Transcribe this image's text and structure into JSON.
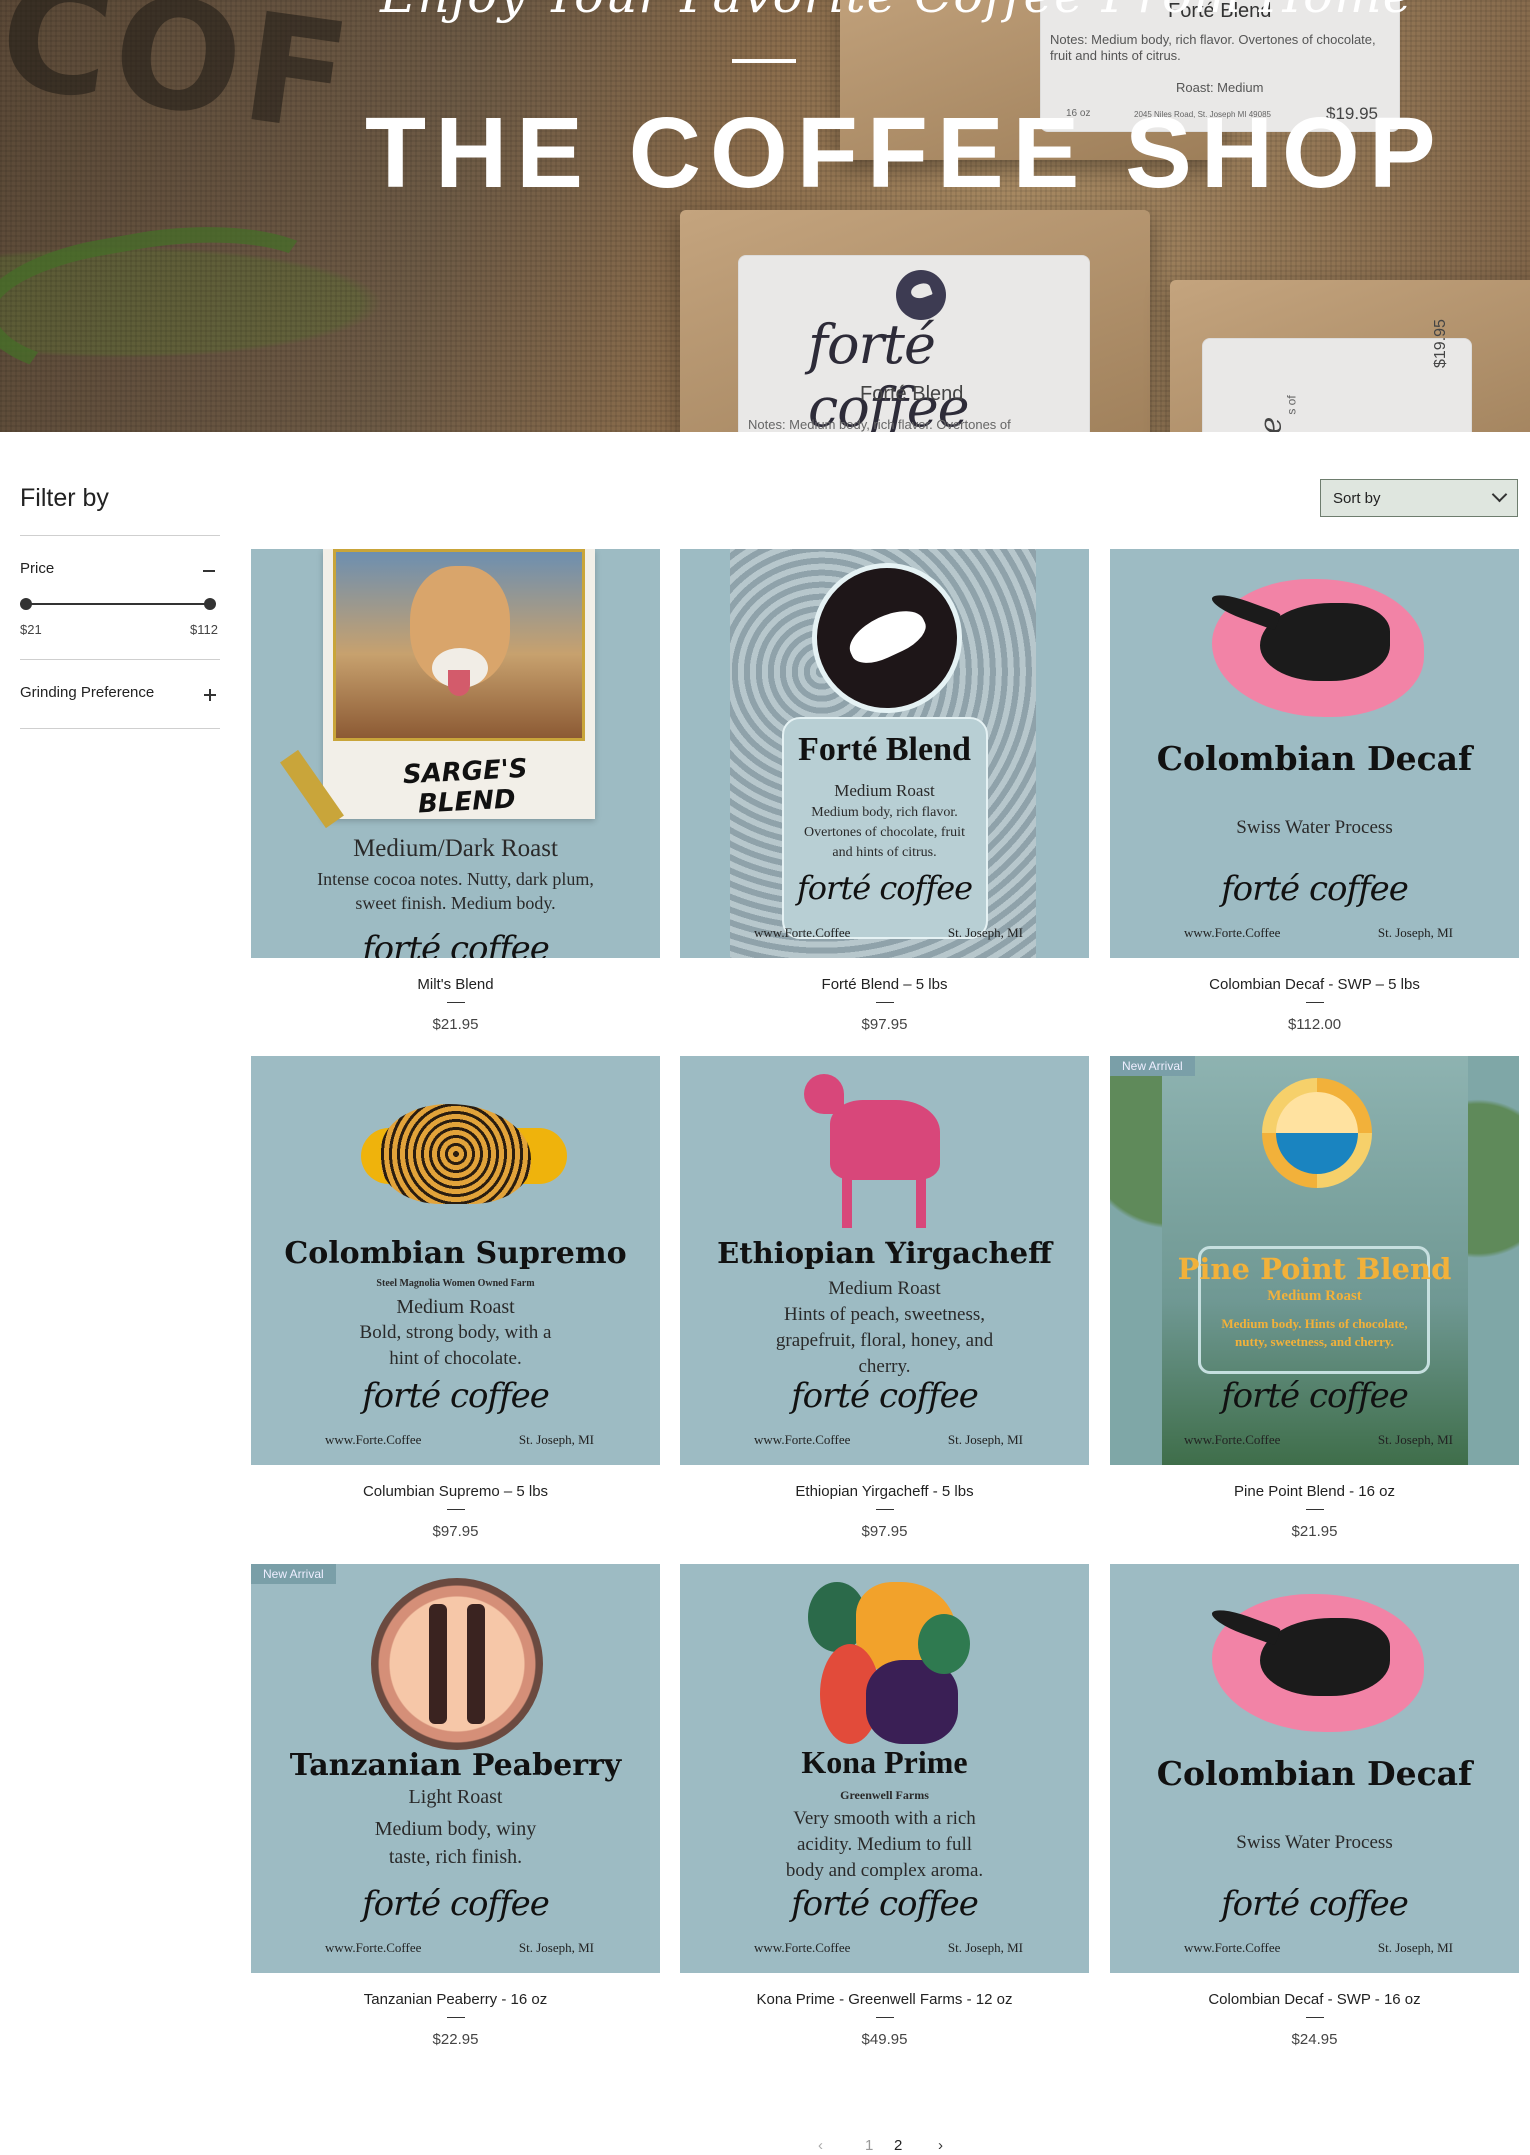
{
  "hero": {
    "tagline": "Enjoy Your Favorite Coffee From Home",
    "shop_name": "THE COFFEE SHOP",
    "bag_label_top": {
      "title": "Forté Blend",
      "notes": "Notes: Medium body, rich flavor. Overtones of chocolate, fruit and hints of citrus.",
      "roast": "Roast: Medium",
      "size": "16 oz",
      "address": "2045 Niles Road, St. Joseph MI 49085",
      "price": "$19.95"
    },
    "bag_label_center": {
      "brand": "forté coffee",
      "title": "Forté Blend",
      "notes": "Notes: Medium body, rich flavor. Overtones of"
    },
    "bag_label_right": {
      "price": "$19.95",
      "notes_fragment": "s of",
      "brand_fragment": "e"
    }
  },
  "filter": {
    "title": "Filter by",
    "price_label": "Price",
    "price_min": "$21",
    "price_max": "$112",
    "grinding_label": "Grinding Preference"
  },
  "sort": {
    "label": "Sort by"
  },
  "products": [
    {
      "name": "Milt's Blend",
      "price": "$21.95",
      "badge": "",
      "label": {
        "title": "SARGE'S BLEND",
        "roast": "Medium/Dark Roast",
        "desc1": "Intense cocoa notes. Nutty, dark plum,",
        "desc2": "sweet finish. Medium body.",
        "brand": "forté coffee"
      }
    },
    {
      "name": "Forté Blend – 5 lbs",
      "price": "$97.95",
      "badge": "",
      "label": {
        "title": "Forté Blend",
        "roast": "Medium Roast",
        "desc1": "Medium body, rich flavor.",
        "desc2": "Overtones of chocolate, fruit",
        "desc3": "and hints of citrus.",
        "brand": "forté coffee",
        "web": "www.Forte.Coffee",
        "city": "St. Joseph, MI"
      }
    },
    {
      "name": "Colombian Decaf - SWP – 5 lbs",
      "price": "$112.00",
      "badge": "",
      "label": {
        "title": "Colombian Decaf",
        "roast": "Swiss Water Process",
        "brand": "forté coffee",
        "web": "www.Forte.Coffee",
        "city": "St. Joseph, MI"
      }
    },
    {
      "name": "Columbian Supremo – 5 lbs",
      "price": "$97.95",
      "badge": "",
      "label": {
        "title": "Colombian Supremo",
        "farm": "Steel Magnolia Women Owned Farm",
        "roast": "Medium Roast",
        "desc1": "Bold, strong body, with a",
        "desc2": "hint of chocolate.",
        "brand": "forté coffee",
        "web": "www.Forte.Coffee",
        "city": "St. Joseph, MI"
      }
    },
    {
      "name": "Ethiopian Yirgacheff - 5 lbs",
      "price": "$97.95",
      "badge": "",
      "label": {
        "title": "Ethiopian Yirgacheff",
        "roast": "Medium Roast",
        "desc1": "Hints of peach, sweetness,",
        "desc2": "grapefruit, floral, honey, and",
        "desc3": "cherry.",
        "brand": "forté coffee",
        "web": "www.Forte.Coffee",
        "city": "St. Joseph, MI"
      }
    },
    {
      "name": "Pine Point Blend - 16 oz",
      "price": "$21.95",
      "badge": "New Arrival",
      "label": {
        "title": "Pine Point Blend",
        "roast": "Medium Roast",
        "desc1": "Medium body. Hints of chocolate,",
        "desc2": "nutty, sweetness, and cherry.",
        "brand": "forté coffee",
        "web": "www.Forte.Coffee",
        "city": "St. Joseph, MI"
      }
    },
    {
      "name": "Tanzanian Peaberry - 16 oz",
      "price": "$22.95",
      "badge": "New Arrival",
      "label": {
        "title": "Tanzanian Peaberry",
        "roast": "Light Roast",
        "desc1": "Medium body, winy",
        "desc2": "taste, rich finish.",
        "brand": "forté coffee",
        "web": "www.Forte.Coffee",
        "city": "St. Joseph, MI"
      }
    },
    {
      "name": "Kona Prime - Greenwell Farms - 12 oz",
      "price": "$49.95",
      "badge": "",
      "label": {
        "title": "Kona Prime",
        "farm": "Greenwell Farms",
        "desc1": "Very smooth with a rich",
        "desc2": "acidity. Medium to full",
        "desc3": "body and complex aroma.",
        "brand": "forté coffee",
        "web": "www.Forte.Coffee",
        "city": "St. Joseph, MI"
      }
    },
    {
      "name": "Colombian Decaf - SWP - 16 oz",
      "price": "$24.95",
      "badge": "",
      "label": {
        "title": "Colombian Decaf",
        "roast": "Swiss Water Process",
        "brand": "forté coffee",
        "web": "www.Forte.Coffee",
        "city": "St. Joseph, MI"
      }
    }
  ],
  "pagination": {
    "page1": "1",
    "page2": "2"
  }
}
